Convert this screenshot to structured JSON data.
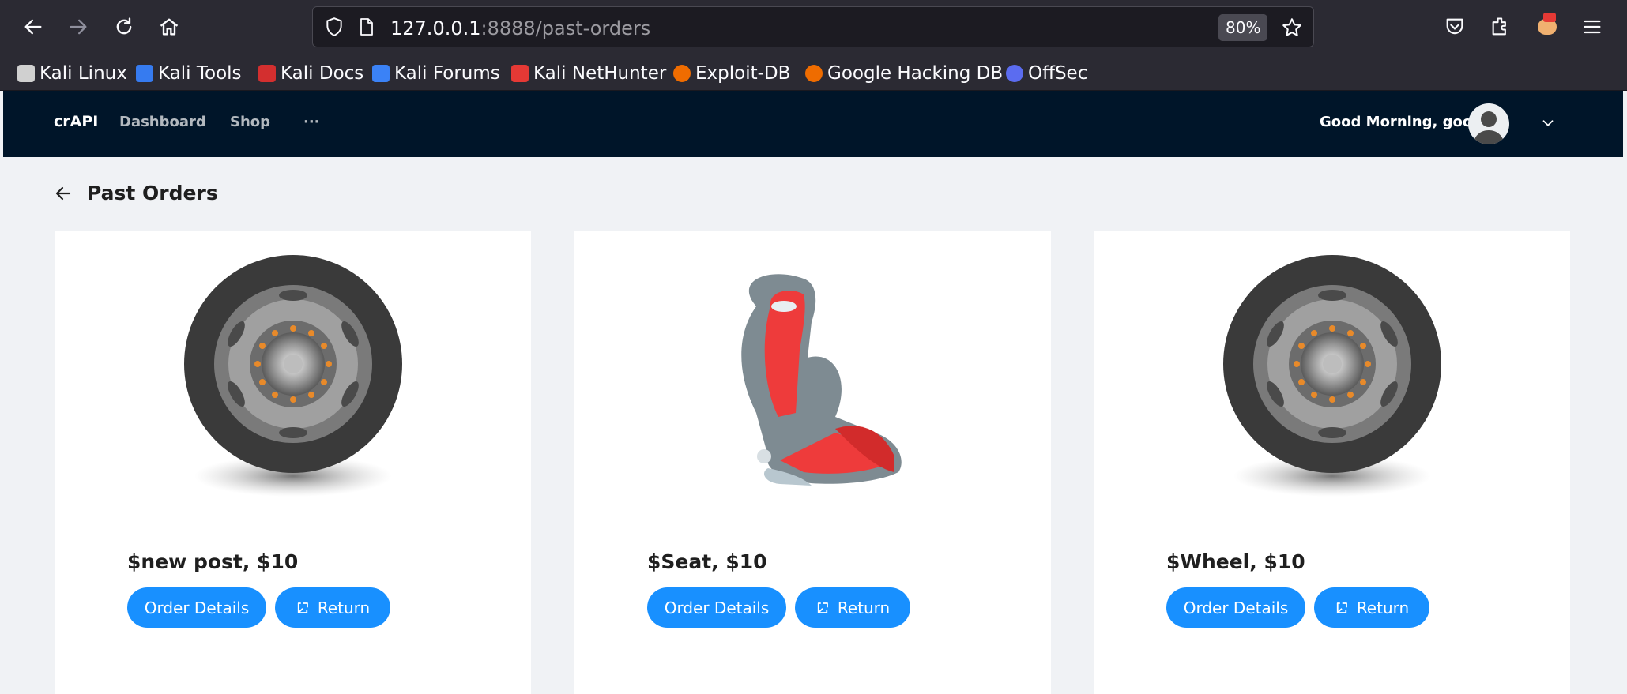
{
  "browser": {
    "url_host": "127.0.0.1",
    "url_path": ":8888/past-orders",
    "zoom": "80%",
    "bookmarks": [
      {
        "label": "Kali Linux",
        "icon": "kali-dragon-icon",
        "color": "#3a3a3a"
      },
      {
        "label": "Kali Tools",
        "icon": "kali-tools-icon",
        "color": "#367bf0"
      },
      {
        "label": "Kali Docs",
        "icon": "kali-docs-icon",
        "color": "#d32f2f"
      },
      {
        "label": "Kali Forums",
        "icon": "kali-forums-icon",
        "color": "#3b82f6"
      },
      {
        "label": "Kali NetHunter",
        "icon": "kali-nethunter-icon",
        "color": "#e53935"
      },
      {
        "label": "Exploit-DB",
        "icon": "exploit-db-icon",
        "color": "#ef6c00"
      },
      {
        "label": "Google Hacking DB",
        "icon": "ghdb-icon",
        "color": "#ef6c00"
      },
      {
        "label": "OffSec",
        "icon": "offsec-icon",
        "color": "#5b6cf0"
      }
    ]
  },
  "app": {
    "brand": "crAPI",
    "nav": [
      "Dashboard",
      "Shop",
      "···"
    ],
    "greeting": "Good Morning, good!",
    "page_title": "Past Orders",
    "accent": "#1890ff",
    "header_bg": "#001529"
  },
  "orders": [
    {
      "title": "$new post, $10",
      "image": "wheel",
      "details_label": "Order Details",
      "return_label": "Return"
    },
    {
      "title": "$Seat, $10",
      "image": "seat",
      "details_label": "Order Details",
      "return_label": "Return"
    },
    {
      "title": "$Wheel, $10",
      "image": "wheel",
      "details_label": "Order Details",
      "return_label": "Return"
    }
  ]
}
